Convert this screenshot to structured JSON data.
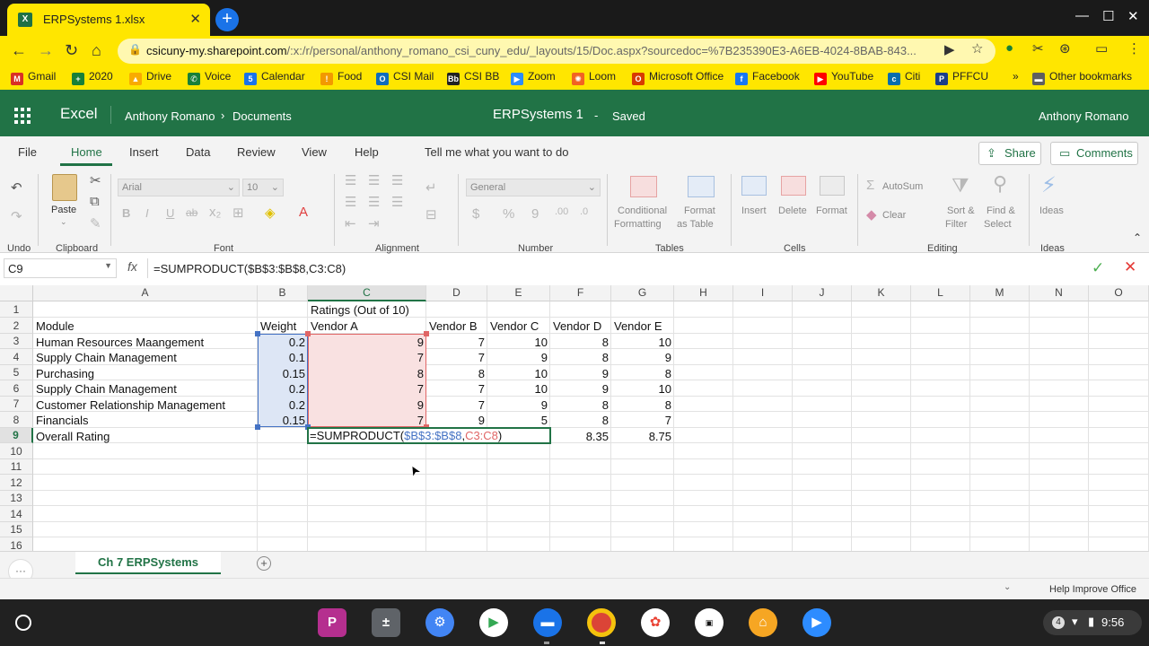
{
  "browser": {
    "tab_title": "ERPSystems 1.xlsx",
    "tab_favicon": "X",
    "url_host": "csicuny-my.sharepoint.com",
    "url_rest": "/:x:/r/personal/anthony_romano_csi_cuny_edu/_layouts/15/Doc.aspx?sourcedoc=%7B235390E3-A6EB-4024-8BAB-843...",
    "bookmarks": [
      {
        "label": "Gmail",
        "icon": "gmail-icon",
        "color": "#d93025",
        "glyph": "M"
      },
      {
        "label": "2020",
        "icon": "sheets-icon",
        "color": "#188038",
        "glyph": "+"
      },
      {
        "label": "Drive",
        "icon": "drive-icon",
        "color": "#f9ab00",
        "glyph": "▲"
      },
      {
        "label": "Voice",
        "icon": "voice-icon",
        "color": "#188038",
        "glyph": "✆"
      },
      {
        "label": "Calendar",
        "icon": "calendar-icon",
        "color": "#1a73e8",
        "glyph": "5"
      },
      {
        "label": "Food",
        "icon": "food-icon",
        "color": "#f29900",
        "glyph": "!"
      },
      {
        "label": "CSI Mail",
        "icon": "outlook-icon",
        "color": "#0f6cbd",
        "glyph": "O"
      },
      {
        "label": "CSI BB",
        "icon": "blackboard-icon",
        "color": "#222222",
        "glyph": "Bb"
      },
      {
        "label": "Zoom",
        "icon": "zoom-icon",
        "color": "#2d8cff",
        "glyph": "▶"
      },
      {
        "label": "Loom",
        "icon": "loom-icon",
        "color": "#f26322",
        "glyph": "✺"
      },
      {
        "label": "Microsoft Office",
        "icon": "office-icon",
        "color": "#d83b01",
        "glyph": "O"
      },
      {
        "label": "Facebook",
        "icon": "facebook-icon",
        "color": "#1877f2",
        "glyph": "f"
      },
      {
        "label": "YouTube",
        "icon": "youtube-icon",
        "color": "#ff0000",
        "glyph": "▶"
      },
      {
        "label": "Citi",
        "icon": "citi-icon",
        "color": "#056dae",
        "glyph": "c"
      },
      {
        "label": "PFFCU",
        "icon": "pffcu-icon",
        "color": "#1a3e8a",
        "glyph": "P"
      }
    ],
    "more_bookmarks": "»",
    "other_bookmarks": "Other bookmarks"
  },
  "excel": {
    "app_name": "Excel",
    "breadcrumb_user": "Anthony Romano",
    "breadcrumb_sep": "›",
    "breadcrumb_folder": "Documents",
    "doc_title": "ERPSystems 1",
    "doc_sep": "-",
    "save_status": "Saved",
    "user_name": "Anthony Romano",
    "ribbon_tabs": [
      "File",
      "Home",
      "Insert",
      "Data",
      "Review",
      "View",
      "Help"
    ],
    "tell_me": "Tell me what you want to do",
    "share": "Share",
    "comments": "Comments",
    "ribbon": {
      "undo_group": "Undo",
      "paste": "Paste",
      "clipboard": "Clipboard",
      "font_name": "Arial",
      "font_size": "10",
      "font_group": "Font",
      "alignment_group": "Alignment",
      "number_format": "General",
      "number_group": "Number",
      "cond_format_1": "Conditional",
      "cond_format_2": "Formatting",
      "format_table_1": "Format",
      "format_table_2": "as Table",
      "tables_group": "Tables",
      "insert": "Insert",
      "delete": "Delete",
      "format": "Format",
      "cells_group": "Cells",
      "autosum": "AutoSum",
      "clear": "Clear",
      "sort_1": "Sort &",
      "sort_2": "Filter",
      "find_1": "Find &",
      "find_2": "Select",
      "editing_group": "Editing",
      "ideas": "Ideas",
      "ideas_group": "Ideas",
      "bold": "B",
      "italic": "I",
      "underline": "U",
      "strike": "ab",
      "currency": "$",
      "percent": "%",
      "comma": "9"
    },
    "name_box": "C9",
    "fx": "fx",
    "formula": "=SUMPRODUCT($B$3:$B$8,C3:C8)",
    "columns": [
      "A",
      "B",
      "C",
      "D",
      "E",
      "F",
      "G",
      "H",
      "I",
      "J",
      "K",
      "L",
      "M",
      "N",
      "O"
    ],
    "rows": [
      "1",
      "2",
      "3",
      "4",
      "5",
      "6",
      "7",
      "8",
      "9",
      "10",
      "11",
      "12",
      "13",
      "14",
      "15",
      "16"
    ],
    "cells": {
      "C1": "Ratings (Out of 10)",
      "A2": "Module",
      "B2": "Weight",
      "C2": "Vendor A",
      "D2": "Vendor B",
      "E2": "Vendor C",
      "F2": "Vendor D",
      "G2": "Vendor E",
      "A3": "Human Resources Maangement",
      "B3": "0.2",
      "C3": "9",
      "D3": "7",
      "E3": "10",
      "F3": "8",
      "G3": "10",
      "A4": "Supply Chain Management",
      "B4": "0.1",
      "C4": "7",
      "D4": "7",
      "E4": "9",
      "F4": "8",
      "G4": "9",
      "A5": "Purchasing",
      "B5": "0.15",
      "C5": "8",
      "D5": "8",
      "E5": "10",
      "F5": "9",
      "G5": "8",
      "A6": "Supply Chain Management",
      "B6": "0.2",
      "C6": "7",
      "D6": "7",
      "E6": "10",
      "F6": "9",
      "G6": "10",
      "A7": "Customer Relationship Management",
      "B7": "0.2",
      "C7": "9",
      "D7": "7",
      "E7": "9",
      "F7": "8",
      "G7": "8",
      "A8": "Financials",
      "B8": "0.15",
      "C8": "7",
      "D8": "9",
      "E8": "5",
      "F8": "8",
      "G8": "7",
      "A9": "Overall Rating",
      "F9": "8.35",
      "G9": "8.75"
    },
    "edit_formula": {
      "prefix": "=SUMPRODUCT(",
      "ref1": "$B$3:$B$8",
      "comma": ",",
      "ref2": "C3:C8",
      "suffix": ")"
    },
    "sheet_tab": "Ch 7 ERPSystems",
    "status_right": "Help Improve Office"
  },
  "os": {
    "clock": "9:56",
    "notif_count": "4"
  },
  "colors": {
    "excel_green": "#217346",
    "browser_yellow": "#ffe600",
    "ref_blue": "#4472c4",
    "ref_red": "#e06666"
  }
}
